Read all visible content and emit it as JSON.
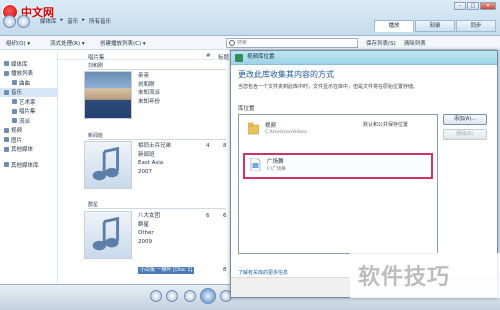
{
  "watermark": {
    "site_name": "中文网"
  },
  "window": {
    "breadcrumb": [
      "媒体库",
      "▸",
      "音乐",
      "▸",
      "所有音乐"
    ],
    "controls": {
      "min": "–",
      "max": "□",
      "close": "✕"
    },
    "tabs": [
      "播放",
      "刻录",
      "同步"
    ]
  },
  "toolbar": {
    "organize": "组织(O) ▾",
    "stream": "流式处理(R) ▾",
    "create_playlist": "创建播放列表(C) ▾",
    "search_placeholder": "搜索",
    "save_list": "保存列表(S)",
    "clear_list": "清除列表"
  },
  "leftnav": {
    "items": [
      {
        "label": "媒体库",
        "level": "top"
      },
      {
        "label": "播放列表",
        "level": "top"
      },
      {
        "label": "曲曲",
        "level": "sub"
      },
      {
        "label": "音乐",
        "level": "top"
      },
      {
        "label": "艺术家",
        "level": "sub"
      },
      {
        "label": "唱片集",
        "level": "sub"
      },
      {
        "label": "流派",
        "level": "sub"
      },
      {
        "label": "视频",
        "level": "top"
      },
      {
        "label": "图片",
        "level": "top"
      },
      {
        "label": "其他媒体",
        "level": "top"
      },
      {
        "label": "其他媒体库",
        "level": "top"
      }
    ]
  },
  "content": {
    "columns": {
      "album": "唱片集",
      "num": "#",
      "title": "标题"
    },
    "groups": [
      {
        "header": "刘和刚",
        "meta": [
          "亲亲",
          "刘和刚",
          "未知流派",
          "未知年份"
        ],
        "num": "",
        "art": "photo"
      },
      {
        "header": "新闻班",
        "meta": [
          "相同士兵兄弟",
          "新闻班",
          "East Asia",
          "2007"
        ],
        "num": "4",
        "art": "note"
      },
      {
        "header": "群星",
        "meta": [
          "八大女团",
          "群星",
          "Other",
          "2009"
        ],
        "num": "6",
        "art": "note",
        "track": "小白兔 一棵叶 [Disc 1]"
      }
    ],
    "right_nums": [
      "8",
      "6",
      "8"
    ]
  },
  "dialog": {
    "title": "视频库位置",
    "heading": "更改此库收集其内容的方式",
    "description": "当您包含一个文件夹到此库中时，文件显示在库中，但是文件将在原始位置存储。",
    "label": "库位置",
    "locations": [
      {
        "name": "视频",
        "path": "C:\\Users\\xx\\Videos",
        "default": "默认和公共保存位置"
      },
      {
        "name": "广场舞",
        "path": "F:\\广场舞"
      }
    ],
    "buttons": {
      "add": "添加(A)...",
      "remove": "删除(R)"
    },
    "link": "了解有关库的更多信息"
  },
  "site_watermark": "软件技巧"
}
